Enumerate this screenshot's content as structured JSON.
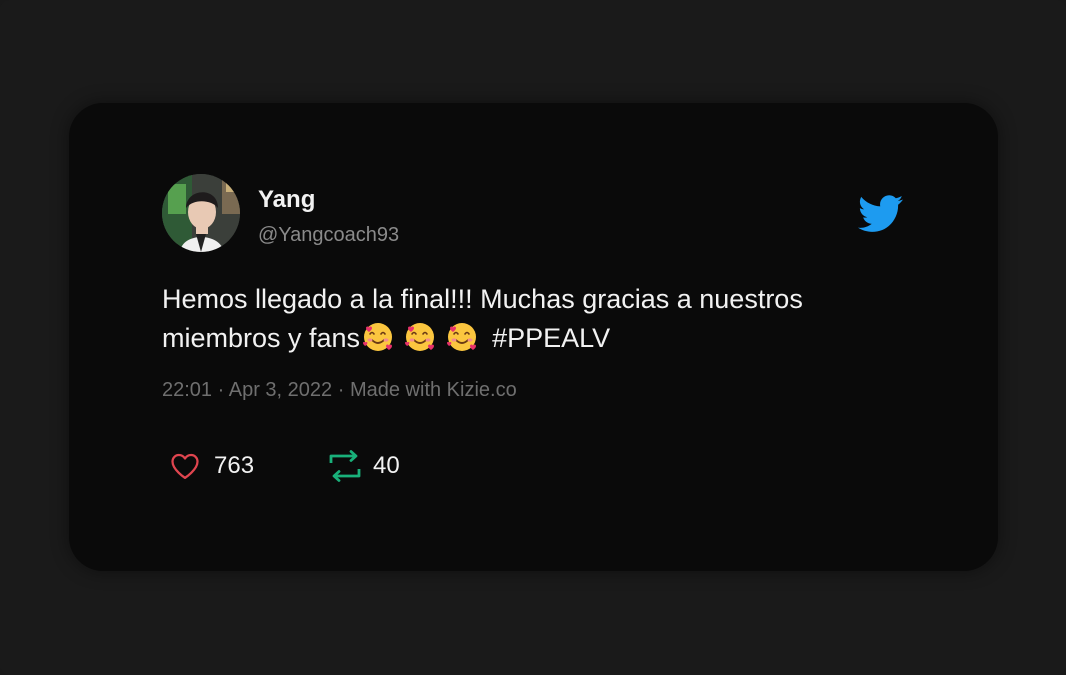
{
  "tweet": {
    "author": {
      "name": "Yang",
      "handle": "@Yangcoach93",
      "avatar_icon": "profile-photo"
    },
    "text": {
      "line1": "Hemos llegado a la final!!!  Muchas gracias a nuestros",
      "line2_prefix": "miembros y fans",
      "hashtag": "#PPEALV",
      "emoji_icon": "smiling-face-with-hearts"
    },
    "meta": {
      "time": "22:01",
      "date": "Apr 3, 2022",
      "credit": "Made with Kizie.co",
      "separator": "·"
    },
    "stats": {
      "likes": "763",
      "retweets": "40"
    },
    "icons": {
      "brand": "twitter-bird-icon",
      "like": "heart-outline-icon",
      "retweet": "retweet-icon"
    }
  },
  "colors": {
    "background": "#1a1a1a",
    "card": "#0a0a0a",
    "twitter_blue": "#1d9bf0",
    "like_red": "#e0454f",
    "retweet_green": "#19b07a",
    "text": "#f2f2f2",
    "muted": "#6f6f6f"
  }
}
